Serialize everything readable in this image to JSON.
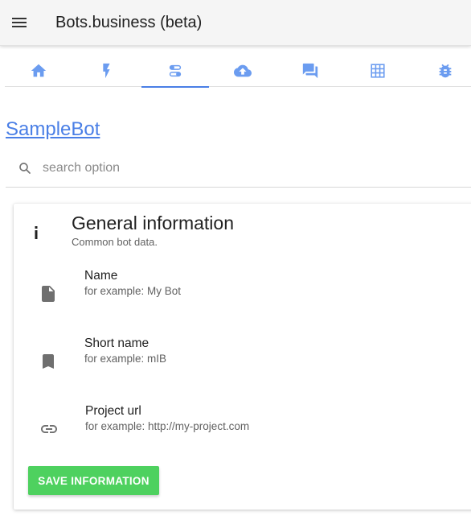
{
  "app": {
    "title": "Bots.business (beta)"
  },
  "tabs": [
    {
      "icon": "home-icon",
      "active": false
    },
    {
      "icon": "flash-icon",
      "active": false
    },
    {
      "icon": "toggles-icon",
      "active": true
    },
    {
      "icon": "cloud-upload-icon",
      "active": false
    },
    {
      "icon": "chat-icon",
      "active": false
    },
    {
      "icon": "grid-icon",
      "active": false
    },
    {
      "icon": "bug-icon",
      "active": false
    }
  ],
  "bot": {
    "name": "SampleBot"
  },
  "search": {
    "placeholder": "search option",
    "value": ""
  },
  "card": {
    "title": "General information",
    "subtitle": "Common bot data.",
    "fields": [
      {
        "label": "Name",
        "hint": "for example: My Bot",
        "icon": "file-icon"
      },
      {
        "label": "Short name",
        "hint": "for example: mIB",
        "icon": "bookmark-icon"
      },
      {
        "label": "Project url",
        "hint": "for example: http://my-project.com",
        "icon": "link-icon"
      }
    ],
    "save_label": "SAVE INFORMATION"
  },
  "colors": {
    "accent": "#4a7fe6",
    "tab_icon": "#6b9cf0",
    "save_button": "#4ed15f",
    "field_icon": "#6f6f6f"
  }
}
